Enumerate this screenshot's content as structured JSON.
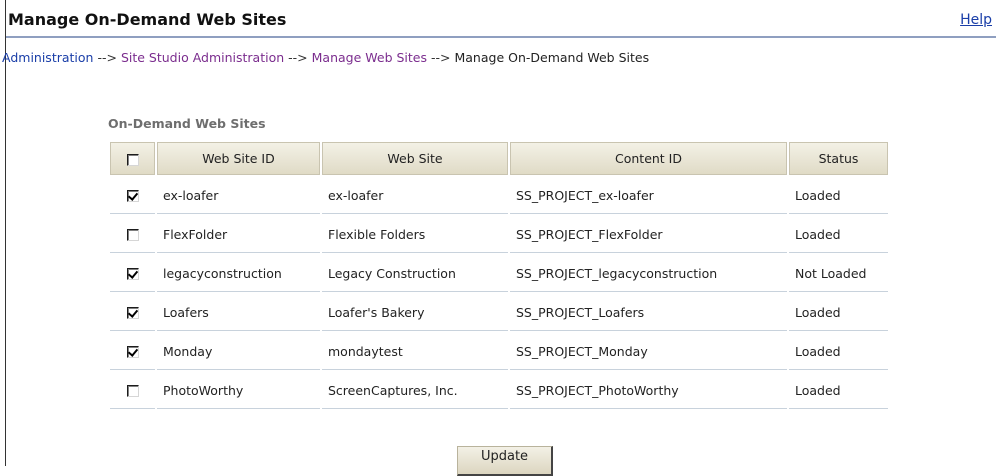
{
  "header": {
    "title": "Manage On-Demand Web Sites",
    "help_label": "Help"
  },
  "breadcrumb": {
    "items": [
      "Administration",
      "Site Studio Administration",
      "Manage Web Sites",
      "Manage On-Demand Web Sites"
    ],
    "separator": "-->"
  },
  "table": {
    "caption": "On-Demand Web Sites",
    "columns": [
      "",
      "Web Site ID",
      "Web Site",
      "Content ID",
      "Status"
    ],
    "select_all_checked": false,
    "rows": [
      {
        "checked": true,
        "id": "ex-loafer",
        "site": "ex-loafer",
        "content_id": "SS_PROJECT_ex-loafer",
        "status": "Loaded"
      },
      {
        "checked": false,
        "id": "FlexFolder",
        "site": "Flexible Folders",
        "content_id": "SS_PROJECT_FlexFolder",
        "status": "Loaded"
      },
      {
        "checked": true,
        "id": "legacyconstruction",
        "site": "Legacy Construction",
        "content_id": "SS_PROJECT_legacyconstruction",
        "status": "Not Loaded"
      },
      {
        "checked": true,
        "id": "Loafers",
        "site": "Loafer's Bakery",
        "content_id": "SS_PROJECT_Loafers",
        "status": "Loaded"
      },
      {
        "checked": true,
        "id": "Monday",
        "site": "mondaytest",
        "content_id": "SS_PROJECT_Monday",
        "status": "Loaded"
      },
      {
        "checked": false,
        "id": "PhotoWorthy",
        "site": "ScreenCaptures, Inc.",
        "content_id": "SS_PROJECT_PhotoWorthy",
        "status": "Loaded"
      }
    ]
  },
  "actions": {
    "update_label": "Update"
  },
  "colors": {
    "link": "#1a3ea8",
    "visited_link": "#7b2d8e",
    "header_rule": "#8f9fc0",
    "table_header_bg": "#e0dbc6"
  }
}
